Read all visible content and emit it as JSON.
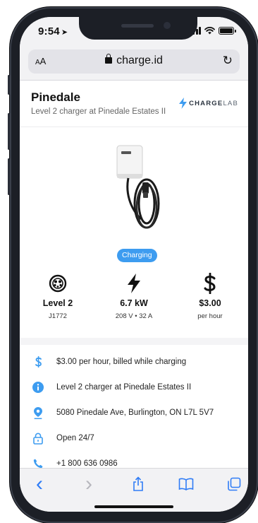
{
  "status_bar": {
    "time": "9:54",
    "location_arrow": "➤"
  },
  "browser": {
    "text_size_label_small": "A",
    "text_size_label_large": "A",
    "domain": "charge.id",
    "reload_glyph": "↻"
  },
  "site_header": {
    "title": "Pinedale",
    "subtitle": "Level 2 charger at Pinedale Estates II",
    "brand_bold": "CHARGE",
    "brand_light": "LAB"
  },
  "charger": {
    "status": "Charging",
    "accent_color": "#3d9cf0",
    "stats": [
      {
        "icon": "connector-icon",
        "value": "Level 2",
        "sub": "J1772"
      },
      {
        "icon": "lightning-icon",
        "value": "6.7 kW",
        "sub": "208 V • 32 A"
      },
      {
        "icon": "dollar-icon",
        "value": "$3.00",
        "sub": "per hour"
      }
    ]
  },
  "details": [
    {
      "icon": "dollar-icon",
      "text": "$3.00 per hour, billed while charging"
    },
    {
      "icon": "info-icon",
      "text": "Level 2 charger at Pinedale Estates II"
    },
    {
      "icon": "location-pin-icon",
      "text": "5080 Pinedale Ave, Burlington, ON L7L 5V7"
    },
    {
      "icon": "lock-icon",
      "text": "Open 24/7"
    },
    {
      "icon": "phone-icon",
      "text": "+1 800 636 0986"
    }
  ],
  "toolbar": {
    "back_glyph": "‹",
    "forward_glyph": "›"
  }
}
